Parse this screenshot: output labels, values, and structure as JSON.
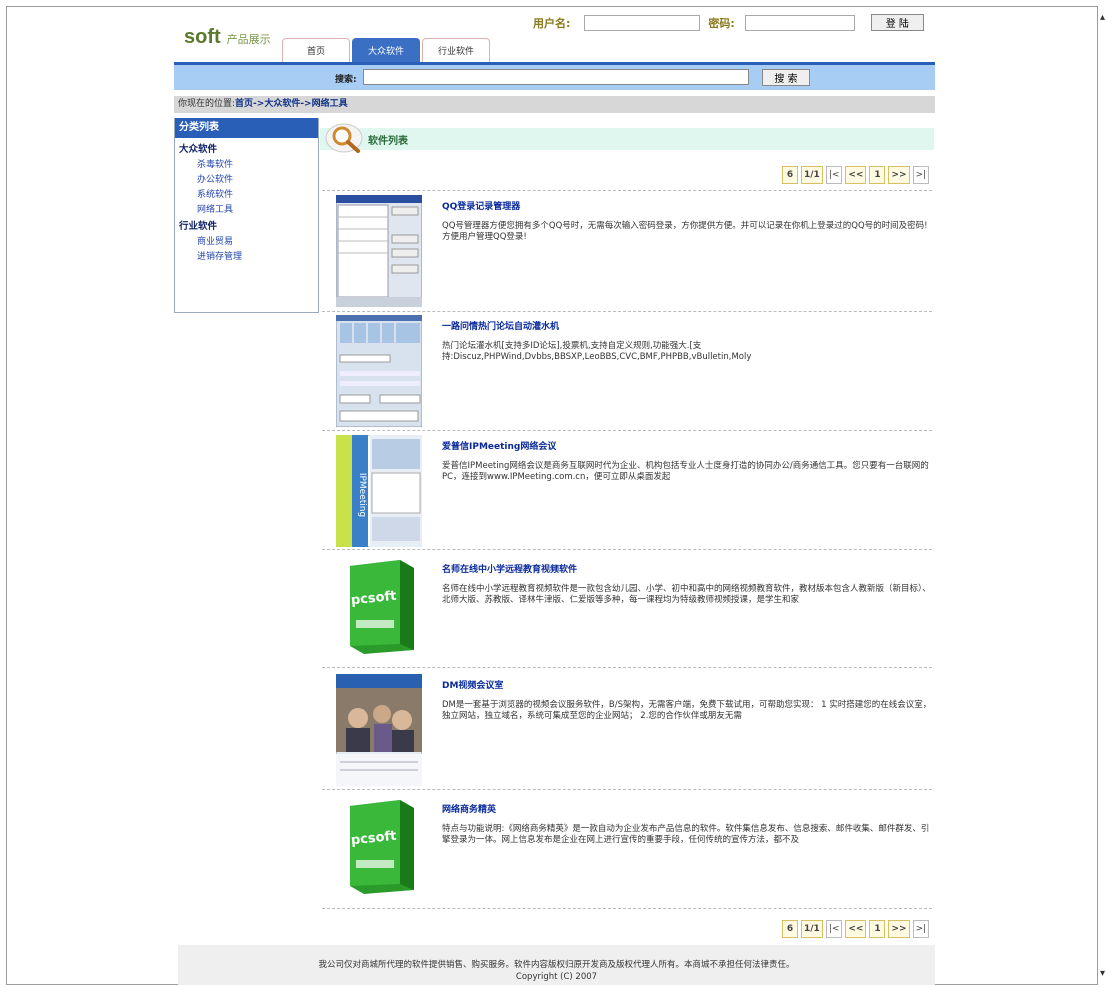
{
  "header": {
    "brand": "soft",
    "brand_sub": "产品展示",
    "username_label": "用户名:",
    "password_label": "密码:",
    "login_button": "登 陆",
    "tabs": [
      {
        "label": "首页",
        "active": false
      },
      {
        "label": "大众软件",
        "active": true
      },
      {
        "label": "行业软件",
        "active": false
      }
    ]
  },
  "search": {
    "label": "搜索:",
    "button": "搜 索"
  },
  "breadcrumb": {
    "prefix": "你现在的位置:",
    "path": "首页->大众软件->网络工具"
  },
  "sidebar": {
    "title": "分类列表",
    "groups": [
      {
        "label": "大众软件",
        "items": [
          "杀毒软件",
          "办公软件",
          "系统软件",
          "网络工具"
        ]
      },
      {
        "label": "行业软件",
        "items": [
          "商业贸易",
          "进销存管理"
        ]
      }
    ]
  },
  "list": {
    "title": "软件列表",
    "pager": [
      "6",
      "1/1",
      "|<",
      "<<",
      "1",
      ">>",
      ">|"
    ],
    "products": [
      {
        "title": "QQ登录记录管理器",
        "desc": "QQ号管理器方便您拥有多个QQ号时，无需每次输入密码登录，方你提供方便。并可以记录在你机上登录过的QQ号的时间及密码!方便用户管理QQ登录!",
        "thumb": "qq"
      },
      {
        "title": "一路问情热门论坛自动灌水机",
        "desc": "热门论坛灌水机[支持多ID论坛],投票机,支持自定义规则,功能强大.[支持:Discuz,PHPWind,Dvbbs,BBSXP,LeoBBS,CVC,BMF,PHPBB,vBulletin,Moly",
        "thumb": "forum"
      },
      {
        "title": "爱普信IPMeeting网络会议",
        "desc": "爱普信IPMeeting网络会议是商务互联网时代为企业、机构包括专业人士度身打造的协同办公/商务通信工具。您只要有一台联网的PC，连接到www.IPMeeting.com.cn，便可立即从桌面发起",
        "thumb": "ipm"
      },
      {
        "title": "名师在线中小学远程教育视频软件",
        "desc": "名师在线中小学远程教育视频软件是一款包含幼儿园、小学、初中和高中的网络视频教育软件，教材版本包含人教新版（新目标）、北师大版、苏教版、译林牛津版、仁爱版等多种，每一课程均为特级教师视频授课，是学生和家",
        "thumb": "box"
      },
      {
        "title": "DM视频会议室",
        "desc": "DM是一套基于浏览器的视频会议服务软件，B/S架构，无需客户端，免费下载试用，可帮助您实现： 1 实时搭建您的在线会议室，独立网站，独立域名，系统可集成至您的企业网站； 2.您的合作伙伴或朋友无需",
        "thumb": "dm"
      },
      {
        "title": "网络商务精英",
        "desc": "特点与功能说明:《网络商务精英》是一款自动为企业发布产品信息的软件。软件集信息发布、信息搜索、邮件收集、邮件群发、引擎登录为一体。网上信息发布是企业在网上进行宣传的重要手段，任何传统的宣传方法，都不及",
        "thumb": "box"
      }
    ]
  },
  "footer": {
    "line1": "我公司仅对商城所代理的软件提供销售、购买服务。软件内容版权归原开发商及版权代理人所有。本商城不承担任何法律责任。",
    "line2": "Copyright (C) 2007"
  },
  "colors": {
    "accent": "#2a5fb8",
    "search_bg": "#a8cdf4",
    "list_header_bg": "#dff7ee",
    "product_title": "#0a2a9a"
  }
}
